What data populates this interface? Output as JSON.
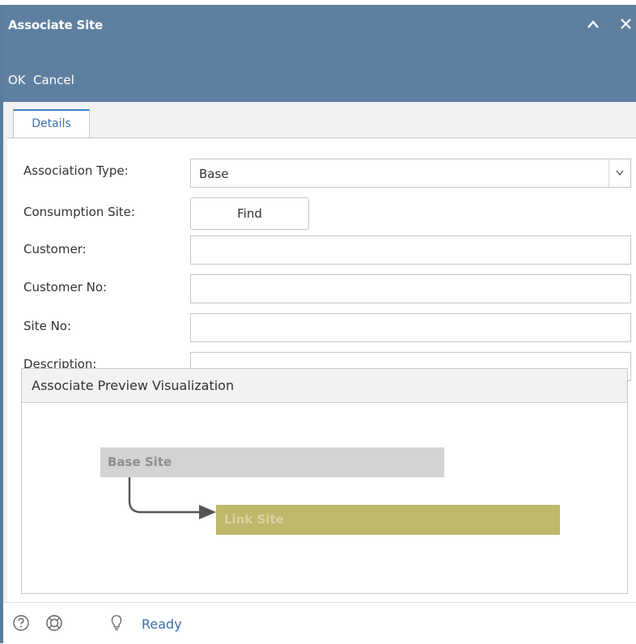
{
  "window": {
    "title": "Associate Site",
    "collapse_icon": "chevron-up-icon",
    "close_icon": "close-icon"
  },
  "toolbar": {
    "ok_label": "OK",
    "cancel_label": "Cancel"
  },
  "tabs": [
    {
      "label": "Details",
      "active": true
    }
  ],
  "form": {
    "association_type": {
      "label": "Association Type:",
      "value": "Base"
    },
    "consumption_site": {
      "label": "Consumption Site:",
      "button": "Find"
    },
    "customer": {
      "label": "Customer:",
      "value": ""
    },
    "customer_no": {
      "label": "Customer No:",
      "value": ""
    },
    "site_no": {
      "label": "Site No:",
      "value": ""
    },
    "description": {
      "label": "Description:",
      "value": ""
    }
  },
  "preview": {
    "title": "Associate Preview Visualization",
    "base_label": "Base Site",
    "link_label": "Link Site"
  },
  "status": {
    "text": "Ready",
    "icons": [
      "help-icon",
      "support-icon",
      "lightbulb-icon"
    ]
  },
  "colors": {
    "titlebar": "#5e80a0",
    "tab_accent": "#3b7fc4",
    "base_site": "#d3d3d3",
    "link_site": "#bdb86a"
  }
}
